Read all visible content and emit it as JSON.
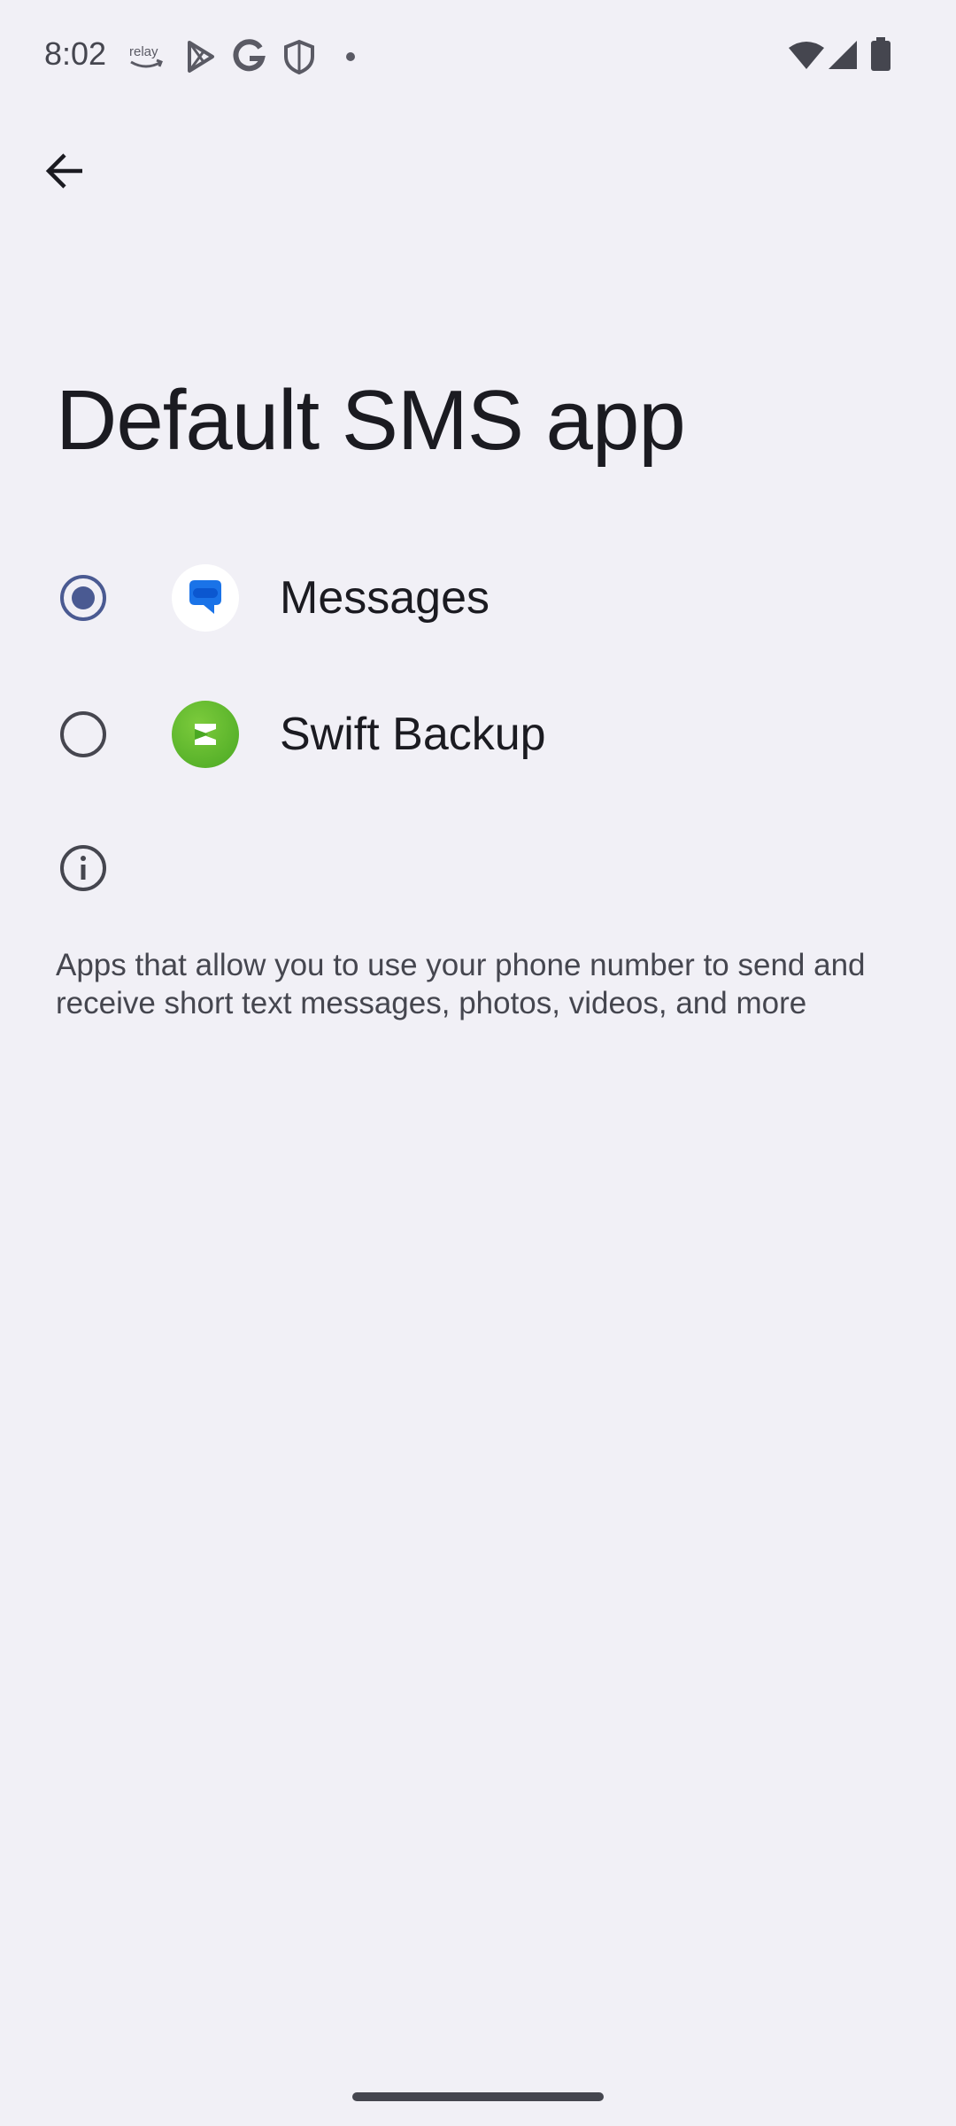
{
  "status_bar": {
    "time": "8:02",
    "relay_label": "relay",
    "icons": [
      "amazon-relay-icon",
      "play-store-icon",
      "google-icon",
      "shield-icon",
      "dot-icon",
      "wifi-icon",
      "signal-icon",
      "battery-icon"
    ]
  },
  "header": {
    "back_icon": "arrow-back-icon"
  },
  "page": {
    "title": "Default SMS app"
  },
  "options": [
    {
      "label": "Messages",
      "selected": true,
      "icon": "messages-app-icon",
      "icon_color": "#1a73e8"
    },
    {
      "label": "Swift Backup",
      "selected": false,
      "icon": "swift-backup-app-icon",
      "icon_color": "#5cb82e"
    }
  ],
  "info": {
    "icon": "info-icon",
    "text": "Apps that allow you to use your phone number to send and receive short text messages, photos, videos, and more"
  },
  "colors": {
    "background": "#f1f0f6",
    "accent": "#4a5a92",
    "text_primary": "#1b1b21",
    "text_secondary": "#45464f"
  }
}
